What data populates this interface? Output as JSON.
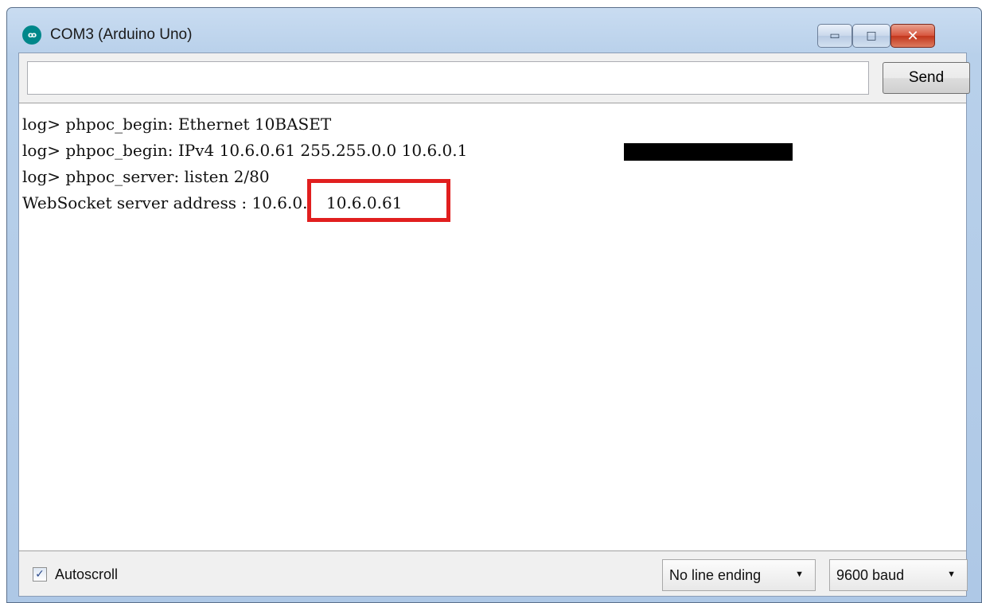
{
  "window": {
    "title": "COM3 (Arduino Uno)",
    "app_icon_glyph": "ꝏ",
    "controls": {
      "minimize": "▭",
      "maximize": "□",
      "close": "✕"
    }
  },
  "input_row": {
    "send_value": "",
    "send_label": "Send"
  },
  "output": {
    "lines": [
      "log> phpoc_begin: Ethernet 10BASET",
      "log> phpoc_begin: IPv4 10.6.0.61 255.255.0.0 10.6.0.1",
      "log> phpoc_server: listen 2/80",
      "WebSocket server address : 10.6.0.61"
    ],
    "highlighted_address": "10.6.0.61",
    "highlight_color": "#e11f1f"
  },
  "status": {
    "autoscroll_checked": true,
    "autoscroll_check_glyph": "✓",
    "autoscroll_label": "Autoscroll",
    "line_ending": "No line ending",
    "baud_rate": "9600 baud",
    "dropdown_glyph": "▼"
  },
  "icons": {
    "app": "arduino-icon",
    "minimize": "minimize-icon",
    "maximize": "maximize-icon",
    "close": "close-icon",
    "checkbox": "checkmark-icon",
    "dropdown": "chevron-down-icon"
  }
}
